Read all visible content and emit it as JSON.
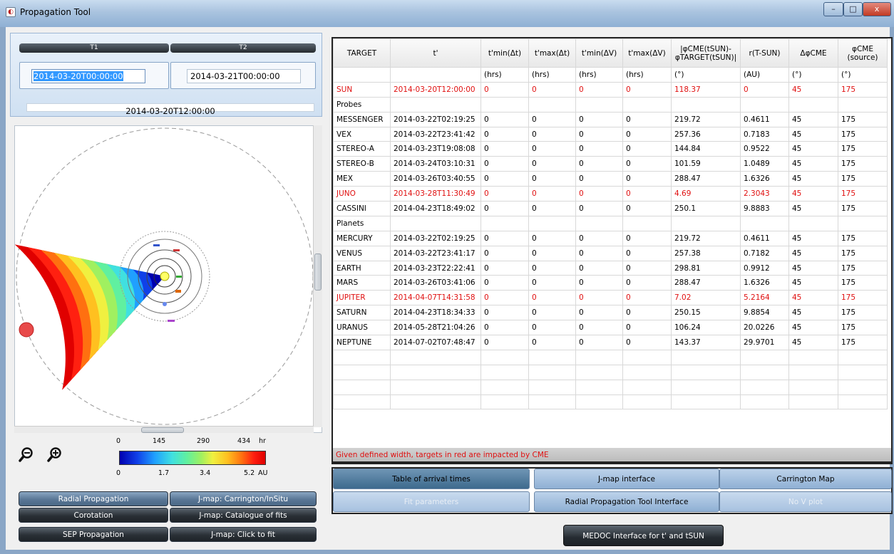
{
  "window": {
    "title": "Propagation Tool",
    "icon": "app-icon",
    "min_glyph": "–",
    "max_glyph": "□",
    "close_glyph": "x"
  },
  "times": {
    "t1_label": "T1",
    "t2_label": "T2",
    "t1_value": "2014-03-20T00:00:00",
    "t2_value": "2014-03-21T00:00:00",
    "tprime_value": "2014-03-20T12:00:00"
  },
  "colorbar": {
    "top_ticks": [
      "0",
      "145",
      "290",
      "434"
    ],
    "top_unit": "hr",
    "bottom_ticks": [
      "0",
      "1.7",
      "3.4",
      "5.2"
    ],
    "bottom_unit": "AU"
  },
  "left_buttons": [
    {
      "label": "Radial Propagation",
      "style": "blue"
    },
    {
      "label": "J-map: Carrington/InSitu",
      "style": "blue"
    },
    {
      "label": "Corotation",
      "style": "dark"
    },
    {
      "label": "J-map: Catalogue of fits",
      "style": "dark"
    },
    {
      "label": "SEP Propagation",
      "style": "dark"
    },
    {
      "label": "J-map: Click to fit",
      "style": "dark"
    }
  ],
  "table": {
    "headers": [
      "TARGET",
      "t'",
      "t'min(Δt)",
      "t'max(Δt)",
      "t'min(ΔV)",
      "t'max(ΔV)",
      "|φCME(tSUN)-φTARGET(tSUN)|",
      "r(T-SUN)",
      "ΔφCME",
      "φCME (source)"
    ],
    "units": [
      "",
      "",
      "(hrs)",
      "(hrs)",
      "(hrs)",
      "(hrs)",
      "(°)",
      "(AU)",
      "(°)",
      "(°)"
    ],
    "rows": [
      {
        "cells": [
          "SUN",
          "2014-03-20T12:00:00",
          "0",
          "0",
          "0",
          "0",
          "118.37",
          "0",
          "45",
          "175"
        ],
        "red": true
      },
      {
        "cells": [
          "Probes",
          "",
          "",
          "",
          "",
          "",
          "",
          "",
          "",
          ""
        ],
        "red": false
      },
      {
        "cells": [
          "MESSENGER",
          "2014-03-22T02:19:25",
          "0",
          "0",
          "0",
          "0",
          "219.72",
          "0.4611",
          "45",
          "175"
        ],
        "red": false
      },
      {
        "cells": [
          "VEX",
          "2014-03-22T23:41:42",
          "0",
          "0",
          "0",
          "0",
          "257.36",
          "0.7183",
          "45",
          "175"
        ],
        "red": false
      },
      {
        "cells": [
          "STEREO-A",
          "2014-03-23T19:08:08",
          "0",
          "0",
          "0",
          "0",
          "144.84",
          "0.9522",
          "45",
          "175"
        ],
        "red": false
      },
      {
        "cells": [
          "STEREO-B",
          "2014-03-24T03:10:31",
          "0",
          "0",
          "0",
          "0",
          "101.59",
          "1.0489",
          "45",
          "175"
        ],
        "red": false
      },
      {
        "cells": [
          "MEX",
          "2014-03-26T03:40:55",
          "0",
          "0",
          "0",
          "0",
          "288.47",
          "1.6326",
          "45",
          "175"
        ],
        "red": false
      },
      {
        "cells": [
          "JUNO",
          "2014-03-28T11:30:49",
          "0",
          "0",
          "0",
          "0",
          "4.69",
          "2.3043",
          "45",
          "175"
        ],
        "red": true
      },
      {
        "cells": [
          "CASSINI",
          "2014-04-23T18:49:02",
          "0",
          "0",
          "0",
          "0",
          "250.1",
          "9.8883",
          "45",
          "175"
        ],
        "red": false
      },
      {
        "cells": [
          "Planets",
          "",
          "",
          "",
          "",
          "",
          "",
          "",
          "",
          ""
        ],
        "red": false
      },
      {
        "cells": [
          "MERCURY",
          "2014-03-22T02:19:25",
          "0",
          "0",
          "0",
          "0",
          "219.72",
          "0.4611",
          "45",
          "175"
        ],
        "red": false
      },
      {
        "cells": [
          "VENUS",
          "2014-03-22T23:41:17",
          "0",
          "0",
          "0",
          "0",
          "257.38",
          "0.7182",
          "45",
          "175"
        ],
        "red": false
      },
      {
        "cells": [
          "EARTH",
          "2014-03-23T22:22:41",
          "0",
          "0",
          "0",
          "0",
          "298.81",
          "0.9912",
          "45",
          "175"
        ],
        "red": false
      },
      {
        "cells": [
          "MARS",
          "2014-03-26T03:41:06",
          "0",
          "0",
          "0",
          "0",
          "288.47",
          "1.6326",
          "45",
          "175"
        ],
        "red": false
      },
      {
        "cells": [
          "JUPITER",
          "2014-04-07T14:31:58",
          "0",
          "0",
          "0",
          "0",
          "7.02",
          "5.2164",
          "45",
          "175"
        ],
        "red": true
      },
      {
        "cells": [
          "SATURN",
          "2014-04-23T18:34:33",
          "0",
          "0",
          "0",
          "0",
          "250.15",
          "9.8854",
          "45",
          "175"
        ],
        "red": false
      },
      {
        "cells": [
          "URANUS",
          "2014-05-28T21:04:26",
          "0",
          "0",
          "0",
          "0",
          "106.24",
          "20.0226",
          "45",
          "175"
        ],
        "red": false
      },
      {
        "cells": [
          "NEPTUNE",
          "2014-07-02T07:48:47",
          "0",
          "0",
          "0",
          "0",
          "143.37",
          "29.9701",
          "45",
          "175"
        ],
        "red": false
      }
    ],
    "empty_rows": 4,
    "footer_note": "Given defined width, targets in red are impacted by CME"
  },
  "nav_buttons": [
    {
      "label": "Table of arrival times",
      "state": "active"
    },
    {
      "label": "J-map interface",
      "state": "normal"
    },
    {
      "label": "Carrington Map",
      "state": "normal"
    },
    {
      "label": "Fit parameters",
      "state": "disabled"
    },
    {
      "label": "Radial Propagation Tool Interface",
      "state": "normal"
    },
    {
      "label": "No V plot",
      "state": "disabled"
    }
  ],
  "medoc_button": "MEDOC Interface for t' and tSUN",
  "plot": {
    "sun_color": "#ffff66",
    "cme_gradient": [
      "#0000b0",
      "#1040e8",
      "#20a0ff",
      "#40e0e0",
      "#60f0a0",
      "#a0f060",
      "#f0f040",
      "#ffc020",
      "#ff7010",
      "#ff2010",
      "#e00000"
    ],
    "zoom_out_icon": "zoom-out-icon",
    "zoom_in_icon": "zoom-in-icon"
  }
}
